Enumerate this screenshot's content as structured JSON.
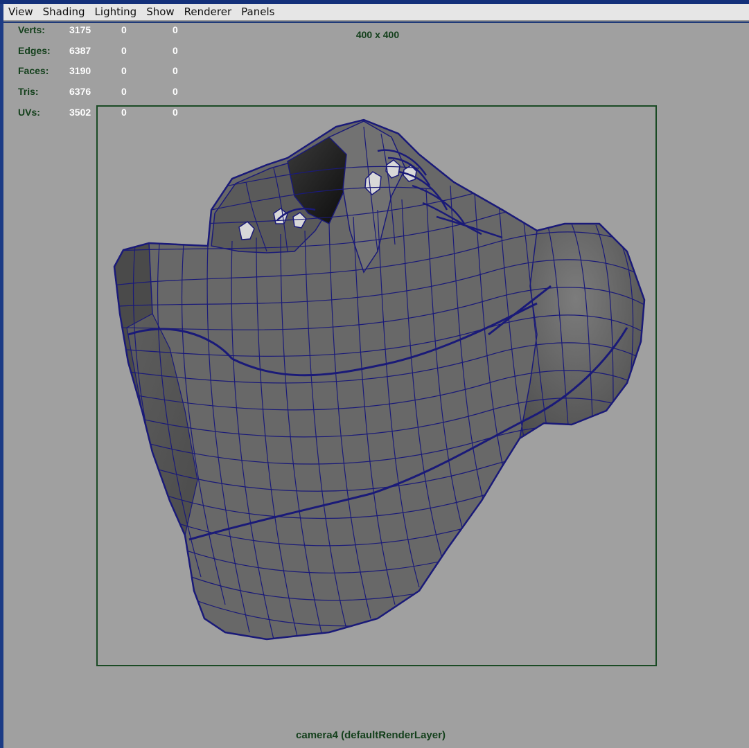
{
  "menubar": {
    "items": [
      "View",
      "Shading",
      "Lighting",
      "Show",
      "Renderer",
      "Panels"
    ]
  },
  "hud": {
    "rows": [
      {
        "label": "Verts:",
        "v1": "3175",
        "v2": "0",
        "v3": "0"
      },
      {
        "label": "Edges:",
        "v1": "6387",
        "v2": "0",
        "v3": "0"
      },
      {
        "label": "Faces:",
        "v1": "3190",
        "v2": "0",
        "v3": "0"
      },
      {
        "label": "Tris:",
        "v1": "6376",
        "v2": "0",
        "v3": "0"
      },
      {
        "label": "UVs:",
        "v1": "3502",
        "v2": "0",
        "v3": "0"
      }
    ]
  },
  "resolution_gate": {
    "label": "400 x 400"
  },
  "camera": {
    "label": "camera4 (defaultRenderLayer)"
  },
  "colors": {
    "viewport_bg": "#a0a0a0",
    "wireframe": "#1a1a78",
    "hud_label": "#14401c",
    "hud_value": "#ffffff",
    "mesh_shade": "#6a6a6a"
  },
  "model": {
    "icon": "shoe-mesh-wireframe"
  }
}
